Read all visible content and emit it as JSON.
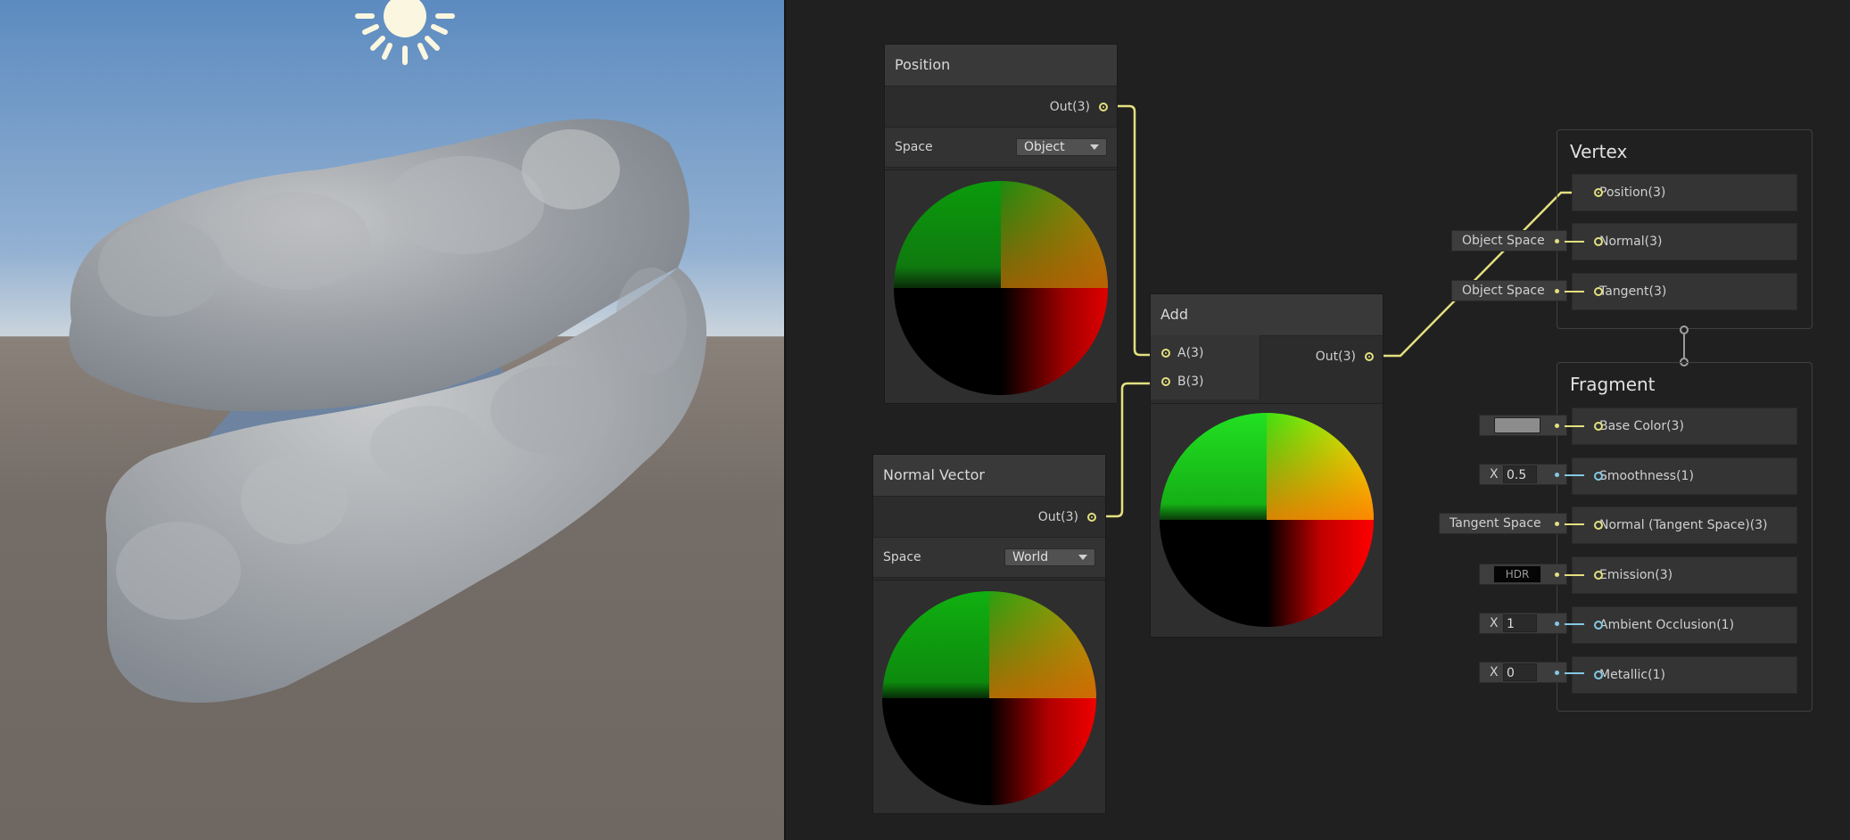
{
  "viewport": {
    "sky_top": "#5f8ec2",
    "horizon": "#c9d3dd",
    "ground": "#716a64",
    "sun_icon": "sun-icon"
  },
  "nodes": {
    "position": {
      "title": "Position",
      "out_label": "Out(3)",
      "space_label": "Space",
      "space_value": "Object"
    },
    "normal_vector": {
      "title": "Normal Vector",
      "out_label": "Out(3)",
      "space_label": "Space",
      "space_value": "World"
    },
    "add": {
      "title": "Add",
      "input_a": "A(3)",
      "input_b": "B(3)",
      "out_label": "Out(3)"
    }
  },
  "vertex": {
    "title": "Vertex",
    "slots": [
      {
        "label": "Position(3)"
      },
      {
        "label": "Normal(3)",
        "default": "Object Space"
      },
      {
        "label": "Tangent(3)",
        "default": "Object Space"
      }
    ]
  },
  "fragment": {
    "title": "Fragment",
    "slots": [
      {
        "label": "Base Color(3)"
      },
      {
        "label": "Smoothness(1)",
        "axis": "X",
        "value": "0.5"
      },
      {
        "label": "Normal (Tangent Space)(3)",
        "default": "Tangent Space"
      },
      {
        "label": "Emission(3)",
        "hdr": "HDR"
      },
      {
        "label": "Ambient Occlusion(1)",
        "axis": "X",
        "value": "1"
      },
      {
        "label": "Metallic(1)",
        "axis": "X",
        "value": "0"
      }
    ]
  },
  "colors": {
    "wire_vector": "#e3e07f",
    "wire_float": "#84c8e3",
    "base_color_swatch": "#8c8c8c"
  }
}
